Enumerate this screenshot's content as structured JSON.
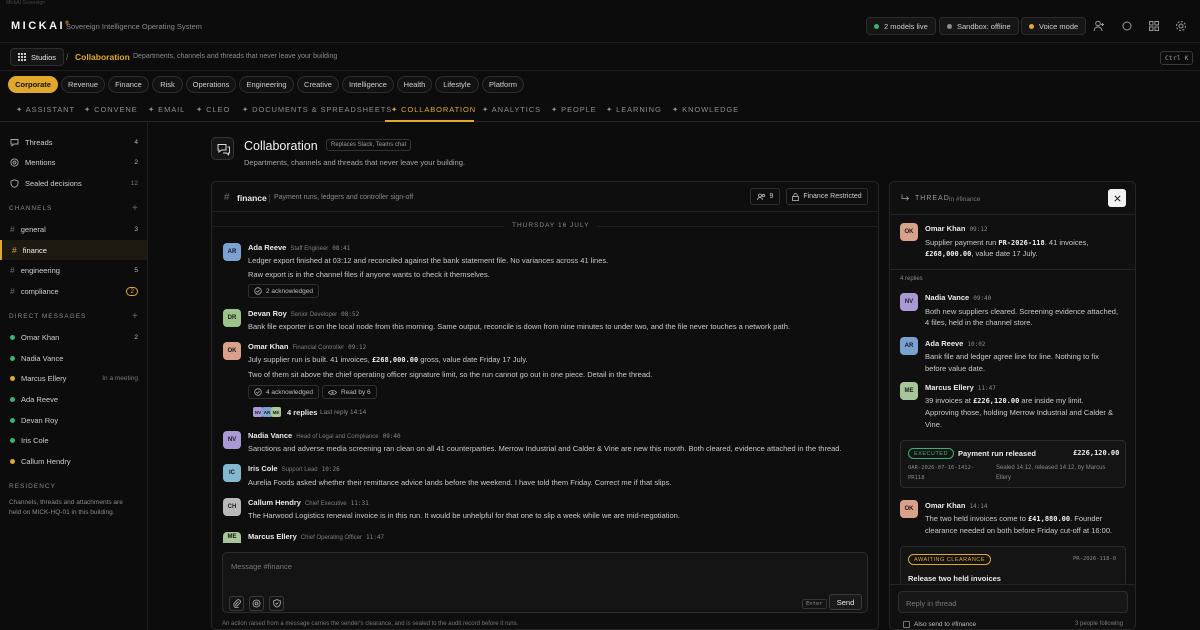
{
  "window_title": "MickAI Sovereign",
  "brand": {
    "logo": "MICKAI",
    "mark": "®",
    "tagline": "Sovereign Intelligence Operating System"
  },
  "status": {
    "models": {
      "label": "2 models live",
      "color": "#3bb273"
    },
    "sandbox": {
      "label": "Sandbox: offline",
      "color": "#8a8a8a"
    },
    "voice": {
      "label": "Voice mode",
      "color": "#e0a92d"
    }
  },
  "topbar_icons": [
    "user-icon",
    "circle-icon",
    "grid-icon",
    "settings-icon"
  ],
  "breadcrumb": {
    "studios": "Studios",
    "sep": "/",
    "current": "Collaboration",
    "desc": "Departments, channels and threads that never leave your building",
    "shortcut": "Ctrl K"
  },
  "categories": [
    "Corporate",
    "Revenue",
    "Finance",
    "Risk",
    "Operations",
    "Engineering",
    "Creative",
    "Intelligence",
    "Health",
    "Lifestyle",
    "Platform"
  ],
  "active_category": "Corporate",
  "nav_tabs": [
    "ASSISTANT",
    "CONVENE",
    "EMAIL",
    "CLEO",
    "DOCUMENTS & SPREADSHEETS",
    "COLLABORATION",
    "ANALYTICS",
    "PEOPLE",
    "LEARNING",
    "KNOWLEDGE"
  ],
  "active_tab": "COLLABORATION",
  "sidebar": {
    "top": [
      {
        "label": "Threads",
        "count": "4",
        "icon": "threads-icon"
      },
      {
        "label": "Mentions",
        "count": "2",
        "icon": "at-icon"
      },
      {
        "label": "Sealed decisions",
        "count": "12",
        "icon": "shield-icon"
      }
    ],
    "channels_title": "CHANNELS",
    "channels": [
      {
        "label": "general",
        "count": "3"
      },
      {
        "label": "finance",
        "count": ""
      },
      {
        "label": "engineering",
        "count": "5"
      },
      {
        "label": "compliance",
        "count": "2"
      }
    ],
    "dm_title": "DIRECT MESSAGES",
    "dms": [
      {
        "label": "Omar Khan",
        "count": "2",
        "color": "#3bb273"
      },
      {
        "label": "Nadia Vance",
        "count": "",
        "color": "#3bb273"
      },
      {
        "label": "Marcus Ellery",
        "count": "In a meeting",
        "color": "#e0a92d"
      },
      {
        "label": "Ada Reeve",
        "count": "",
        "color": "#3bb273"
      },
      {
        "label": "Devan Roy",
        "count": "",
        "color": "#3bb273"
      },
      {
        "label": "Iris Cole",
        "count": "",
        "color": "#3bb273"
      },
      {
        "label": "Callum Hendry",
        "count": "",
        "color": "#e0a92d"
      }
    ],
    "residency_title": "RESIDENCY",
    "residency_line1": "Channels, threads and attachments are",
    "residency_line2": "held on MICK-HQ-01 in this building."
  },
  "page": {
    "title": "Collaboration",
    "badge": "Replaces Slack, Teams chat",
    "subtitle": "Departments, channels and threads that never leave your building."
  },
  "channel": {
    "name": "finance",
    "desc": "Payment runs, ledgers and controller sign-off",
    "members": "9",
    "restriction": "Finance Restricted",
    "date_divider": "THURSDAY 16 JULY",
    "composer_placeholder": "Message #finance",
    "enter_hint": "Enter",
    "send": "Send",
    "footer_note": "An action raised from a message carries the sender's clearance, and is sealed to the audit record before it runs."
  },
  "messages": [
    {
      "initials": "AR",
      "color": "#7aa1d2",
      "name": "Ada Reeve",
      "role": "Staff Engineer",
      "time": "08:41",
      "l1": "Ledger export finished at 03:12 and reconciled against the bank statement file. No variances across 41 lines.",
      "l2": "Raw export is in the channel files if anyone wants to check it themselves.",
      "ack": "2 acknowledged"
    },
    {
      "initials": "DR",
      "color": "#9cc48a",
      "name": "Devan Roy",
      "role": "Senior Developer",
      "time": "08:52",
      "l1": "Bank file exporter is on the local node from this morning. Same output, reconcile is down from nine minutes to under two, and the file never touches a network path."
    },
    {
      "initials": "OK",
      "color": "#d9a08a",
      "name": "Omar Khan",
      "role": "Financial Controller",
      "time": "09:12",
      "l1a": "July supplier run is built. 41 invoices, ",
      "l1amt": "£268,000.00",
      "l1b": " gross, value date Friday 17 July.",
      "l2": "Two of them sit above the chief operating officer signature limit, so the run cannot go out in one piece. Detail in the thread.",
      "ack": "4 acknowledged",
      "read": "Read by 6",
      "replies": "4 replies",
      "last_reply": "Last reply 14:14",
      "stack": [
        "NV",
        "AR",
        "ME"
      ]
    },
    {
      "initials": "NV",
      "color": "#a99ad6",
      "name": "Nadia Vance",
      "role": "Head of Legal and Compliance",
      "time": "09:40",
      "l1": "Sanctions and adverse media screening ran clean on all 41 counterparties. Merrow Industrial and Calder & Vine are new this month. Both cleared, evidence attached in the thread."
    },
    {
      "initials": "IC",
      "color": "#84b8d0",
      "name": "Iris Cole",
      "role": "Support Lead",
      "time": "10:26",
      "l1": "Aurelia Foods asked whether their remittance advice lands before the weekend. I have told them Friday. Correct me if that slips."
    },
    {
      "initials": "CH",
      "color": "#b9b9b9",
      "name": "Callum Hendry",
      "role": "Chief Executive",
      "time": "11:31",
      "l1": "The Harwood Logistics renewal invoice is in this run. It would be unhelpful for that one to slip a week while we are mid-negotiation."
    },
    {
      "initials": "ME",
      "color": "#a7c79a",
      "name": "Marcus Ellery",
      "role": "Chief Operating Officer",
      "time": "11:47"
    }
  ],
  "thread": {
    "title": "THREAD",
    "channel": "in #finance",
    "root": {
      "initials": "OK",
      "color": "#d9a08a",
      "name": "Omar Khan",
      "time": "09:12",
      "l1a": "Supplier payment run ",
      "ref": "PR-2026-118",
      "l1b": ". 41 invoices,",
      "amt": "£268,000.00",
      "l2b": ", value date 17 July."
    },
    "replies_label": "4 replies",
    "replies": [
      {
        "initials": "NV",
        "color": "#a99ad6",
        "name": "Nadia Vance",
        "time": "09:40",
        "l1": "Both new suppliers cleared. Screening evidence attached,",
        "l2": "4 files, held in the channel store."
      },
      {
        "initials": "AR",
        "color": "#7aa1d2",
        "name": "Ada Reeve",
        "time": "10:02",
        "l1": "Bank file and ledger agree line for line. Nothing to fix",
        "l2": "before value date."
      },
      {
        "initials": "ME",
        "color": "#a7c79a",
        "name": "Marcus Ellery",
        "time": "11:47",
        "l1a": "39 invoices at ",
        "amt": "£226,120.00",
        "l1b": " are inside my limit.",
        "l2": "Approving those, holding Merrow Industrial and Calder &",
        "l3": "Vine."
      }
    ],
    "executed": {
      "badge": "EXECUTED",
      "title": "Payment run released",
      "amount": "£226,120.00",
      "ref1": "OAR-2026-07-16-1412-",
      "ref2": "PR118",
      "note1": "Sealed 14:12, released 14:12, by Marcus",
      "note2": "Ellery"
    },
    "last": {
      "initials": "OK",
      "color": "#d9a08a",
      "name": "Omar Khan",
      "time": "14:14",
      "l1a": "The two held invoices come to ",
      "amt": "£41,880.00",
      "l1b": ". Founder",
      "l2": "clearance needed on both before Friday cut-off at 16:00."
    },
    "awaiting": {
      "badge": "AWAITING CLEARANCE",
      "ref": "PR-2026-118-0",
      "title": "Release two held invoices"
    },
    "reply_placeholder": "Reply in thread",
    "also_send": "Also send to #finance",
    "following": "3 people following"
  }
}
